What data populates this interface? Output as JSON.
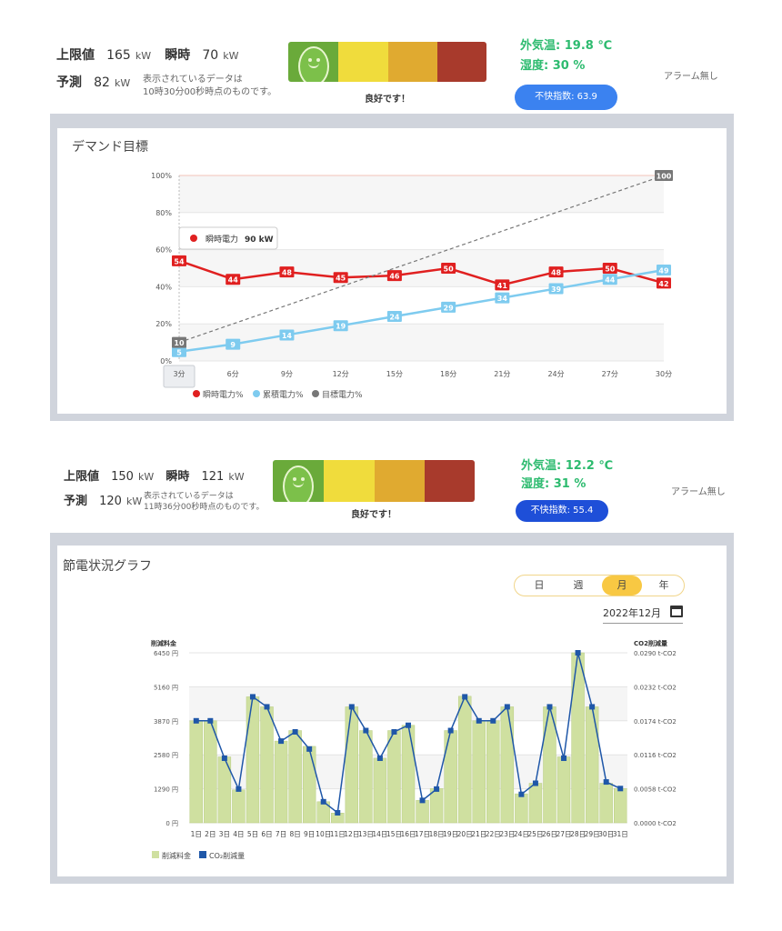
{
  "top": {
    "upper_label": "上限値",
    "upper_value": "165",
    "unit": "kW",
    "instant_label": "瞬時",
    "instant_value": "70",
    "forecast_label": "予測",
    "forecast_value": "82",
    "note_line1": "表示されているデータは",
    "note_line2": "10時30分00秒時点のものです。",
    "status_text": "良好です！",
    "outside_temp": "外気温: 19.8 ℃",
    "humidity": "湿度: 30 %",
    "discomfort": "不快指数: 63.9",
    "alarm": "アラーム無し"
  },
  "demand": {
    "title": "デマンド目標",
    "tooltip_series": "瞬時電力",
    "tooltip_value": "90 kW",
    "legend": [
      "瞬時電力%",
      "累積電力%",
      "目標電力%"
    ]
  },
  "bottom": {
    "upper_label": "上限値",
    "upper_value": "150",
    "unit": "kW",
    "instant_label": "瞬時",
    "instant_value": "121",
    "forecast_label": "予測",
    "forecast_value": "120",
    "note_line1": "表示されているデータは",
    "note_line2": "11時36分00秒時点のものです。",
    "status_text": "良好です！",
    "outside_temp": "外気温: 12.2 ℃",
    "humidity": "湿度: 31 %",
    "discomfort": "不快指数: 55.4",
    "alarm": "アラーム無し"
  },
  "savings": {
    "title": "節電状況グラフ",
    "tabs": [
      "日",
      "週",
      "月",
      "年"
    ],
    "active_tab": "月",
    "month": "2022年12月",
    "legend": [
      "削減料金",
      "CO₂削減量"
    ]
  },
  "colors": {
    "face_green": "#6aaa3a",
    "face_yellow": "#f0dc3c",
    "face_orange": "#e0aa30",
    "face_red": "#a83a2c",
    "instant_red": "#e02020",
    "cumulative_blue": "#7ecbef",
    "target_gray": "#777777",
    "bar_fill": "#cfe0a0",
    "co2_line": "#1f57a8",
    "pill_light": "#3b82f0",
    "pill_dark": "#1e4fd8"
  },
  "chart_data": [
    {
      "type": "line",
      "x": [
        "3分",
        "6分",
        "9分",
        "12分",
        "15分",
        "18分",
        "21分",
        "24分",
        "27分",
        "30分"
      ],
      "ylim": [
        0,
        100
      ],
      "yticks": [
        "0%",
        "20%",
        "40%",
        "60%",
        "80%",
        "100%"
      ],
      "series": [
        {
          "name": "瞬時電力%",
          "values": [
            54,
            44,
            48,
            45,
            46,
            50,
            41,
            48,
            50,
            42
          ]
        },
        {
          "name": "累積電力%",
          "values": [
            5,
            9,
            14,
            19,
            24,
            29,
            34,
            39,
            44,
            49
          ]
        },
        {
          "name": "目標電力%",
          "values": [
            10,
            null,
            null,
            null,
            null,
            null,
            null,
            null,
            null,
            100
          ]
        }
      ],
      "x_selected": "3分",
      "legend": "bottom",
      "grid": true
    },
    {
      "type": "bar",
      "categories": [
        "1日",
        "2日",
        "3日",
        "4日",
        "5日",
        "6日",
        "7日",
        "8日",
        "9日",
        "10日",
        "11日",
        "12日",
        "13日",
        "14日",
        "15日",
        "16日",
        "17日",
        "18日",
        "19日",
        "20日",
        "21日",
        "22日",
        "23日",
        "24日",
        "25日",
        "26日",
        "27日",
        "28日",
        "29日",
        "30日",
        "31日"
      ],
      "ylabel": "削減料金",
      "y2label": "CO2削減量",
      "ylim": [
        0,
        6450
      ],
      "yticks": [
        "0 円",
        "1290 円",
        "2580 円",
        "3870 円",
        "5160 円",
        "6450 円"
      ],
      "y2ticks": [
        "0.0000 t-CO2",
        "0.0058 t-CO2",
        "0.0116 t-CO2",
        "0.0174 t-CO2",
        "0.0232 t-CO2",
        "0.0290 t-CO2"
      ],
      "series": [
        {
          "name": "削減料金",
          "values": [
            3870,
            3870,
            2500,
            1250,
            4780,
            4400,
            3100,
            3500,
            2900,
            800,
            370,
            4400,
            3500,
            2450,
            3500,
            3700,
            850,
            1300,
            3500,
            4800,
            3870,
            3870,
            4400,
            1100,
            1500,
            4400,
            2500,
            6450,
            4400,
            1500,
            1300
          ]
        },
        {
          "name": "CO₂削減量",
          "values": [
            3870,
            3870,
            2450,
            1280,
            4780,
            4400,
            3100,
            3450,
            2800,
            800,
            380,
            4400,
            3500,
            2450,
            3450,
            3700,
            850,
            1280,
            3500,
            4780,
            3870,
            3870,
            4400,
            1080,
            1500,
            4400,
            2450,
            6450,
            4400,
            1550,
            1300
          ]
        }
      ],
      "legend": "bottom-left",
      "grid": true
    }
  ]
}
